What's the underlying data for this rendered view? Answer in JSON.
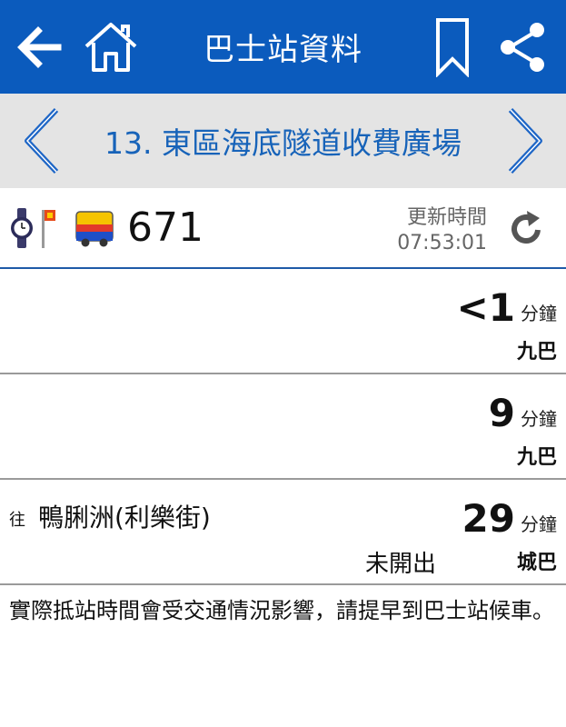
{
  "header": {
    "title": "巴士站資料",
    "icons": [
      "back-arrow-icon",
      "home-icon",
      "bookmark-icon",
      "share-icon"
    ]
  },
  "stop": {
    "name": "13. 東區海底隧道收費廣場",
    "icons": [
      "chevron-left-icon",
      "chevron-right-icon"
    ]
  },
  "route": {
    "number": "671",
    "update_label": "更新時間",
    "update_time": "07:53:01",
    "icons": [
      "watch-stop-icon",
      "bus-icon",
      "refresh-icon"
    ]
  },
  "arrivals": [
    {
      "eta": "<1",
      "unit": "分鐘",
      "company": "九巴"
    },
    {
      "eta": "9",
      "unit": "分鐘",
      "company": "九巴"
    },
    {
      "dest_prefix": "往",
      "destination": "鴨脷洲(利樂街)",
      "eta": "29",
      "unit": "分鐘",
      "company": "城巴",
      "status": "未開出"
    }
  ],
  "note": "實際抵站時間會受交通情況影響，請提早到巴士站候車。",
  "colors": {
    "header_bg": "#0b5bbd",
    "stop_bar_bg": "#e4e4e4",
    "stop_name": "#1763b9"
  }
}
